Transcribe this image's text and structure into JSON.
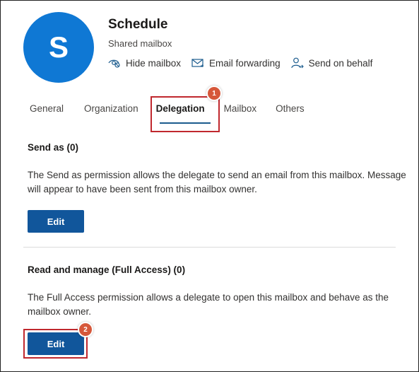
{
  "header": {
    "avatar_initial": "S",
    "avatar_color": "#0f78d4",
    "title": "Schedule",
    "subtitle": "Shared mailbox",
    "actions": [
      {
        "label": "Hide mailbox",
        "icon": "hide-mailbox-icon"
      },
      {
        "label": "Email forwarding",
        "icon": "email-forwarding-icon"
      },
      {
        "label": "Send on behalf",
        "icon": "send-on-behalf-icon"
      }
    ]
  },
  "tabs": [
    {
      "label": "General"
    },
    {
      "label": "Organization"
    },
    {
      "label": "Delegation",
      "active": true
    },
    {
      "label": "Mailbox"
    },
    {
      "label": "Others"
    }
  ],
  "sections": [
    {
      "title": "Send as (0)",
      "description": "The Send as permission allows the delegate to send an email from this mailbox. Message will appear to have been sent from this mailbox owner.",
      "button_label": "Edit"
    },
    {
      "title": "Read and manage (Full Access) (0)",
      "description": "The Full Access permission allows a delegate to open this mailbox and behave as the mailbox owner.",
      "button_label": "Edit"
    }
  ],
  "annotations": [
    {
      "number": "1",
      "target": "Delegation tab"
    },
    {
      "number": "2",
      "target": "Read and manage Edit button"
    }
  ],
  "colors": {
    "accent": "#11569b",
    "callout_border": "#c0282e",
    "badge": "#d6573a"
  }
}
